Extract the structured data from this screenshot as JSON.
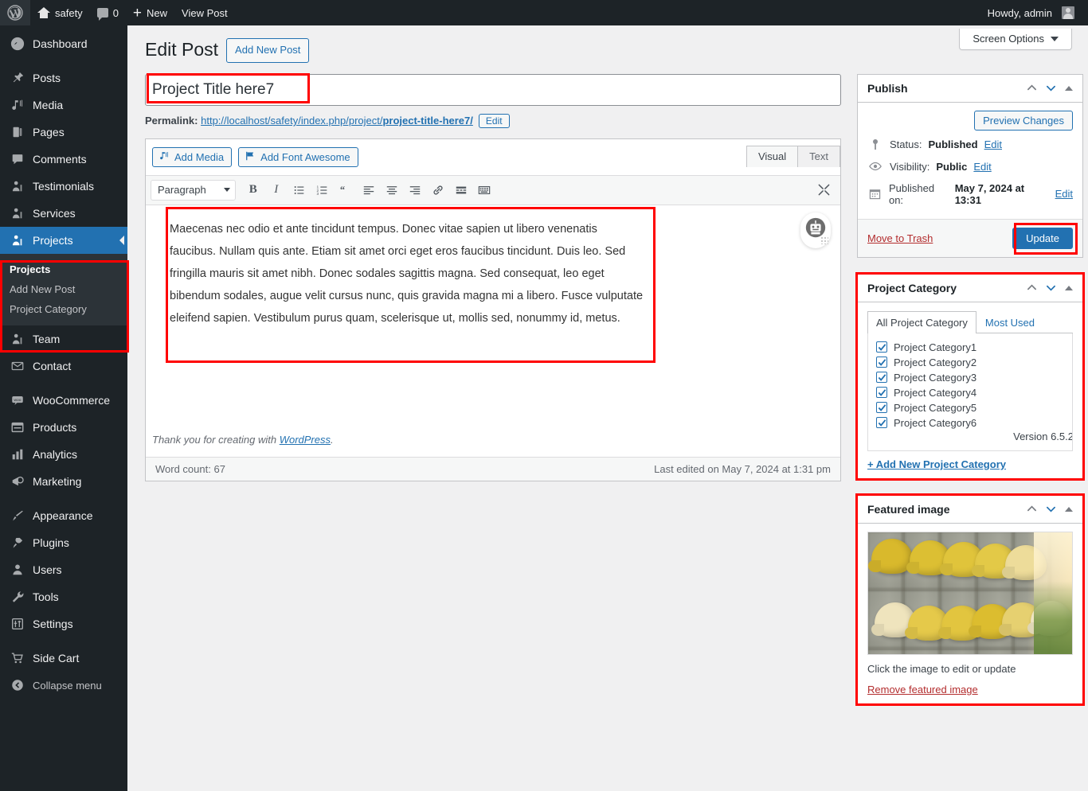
{
  "adminbar": {
    "logo_icon": "wordpress-logo-icon",
    "site_name": "safety",
    "comment_count": "0",
    "new_label": "New",
    "view_post_label": "View Post",
    "howdy": "Howdy, admin"
  },
  "sidebar": {
    "items": [
      {
        "label": "Dashboard",
        "icon": "dashboard-icon"
      },
      {
        "label": "Posts",
        "icon": "pin-icon"
      },
      {
        "label": "Media",
        "icon": "media-icon"
      },
      {
        "label": "Pages",
        "icon": "pages-icon"
      },
      {
        "label": "Comments",
        "icon": "comments-icon"
      },
      {
        "label": "Testimonials",
        "icon": "person-icon"
      },
      {
        "label": "Services",
        "icon": "person-icon"
      },
      {
        "label": "Projects",
        "icon": "person-icon",
        "current": true
      },
      {
        "label": "Team",
        "icon": "person-icon"
      },
      {
        "label": "Contact",
        "icon": "envelope-icon"
      },
      {
        "label": "WooCommerce",
        "icon": "woo-icon"
      },
      {
        "label": "Products",
        "icon": "products-icon"
      },
      {
        "label": "Analytics",
        "icon": "chart-bar-icon"
      },
      {
        "label": "Marketing",
        "icon": "megaphone-icon"
      },
      {
        "label": "Appearance",
        "icon": "paintbrush-icon"
      },
      {
        "label": "Plugins",
        "icon": "plug-icon"
      },
      {
        "label": "Users",
        "icon": "user-icon"
      },
      {
        "label": "Tools",
        "icon": "wrench-icon"
      },
      {
        "label": "Settings",
        "icon": "sliders-icon"
      },
      {
        "label": "Side Cart",
        "icon": "cart-icon"
      }
    ],
    "projects_submenu": [
      {
        "label": "Projects",
        "current": true
      },
      {
        "label": "Add New Post",
        "current": false
      },
      {
        "label": "Project Category",
        "current": false
      }
    ],
    "collapse_label": "Collapse menu"
  },
  "screen_options": {
    "label": "Screen Options"
  },
  "page": {
    "title": "Edit Post",
    "add_new_label": "Add New Post"
  },
  "post": {
    "title_value": "Project Title here7",
    "title_placeholder": "Add title",
    "permalink_label": "Permalink:",
    "permalink_base": "http://localhost/safety/index.php/project/",
    "permalink_slug": "project-title-here7/",
    "permalink_edit_label": "Edit"
  },
  "editor": {
    "add_media_label": "Add Media",
    "add_font_awesome_label": "Add Font Awesome",
    "tab_visual": "Visual",
    "tab_text": "Text",
    "format_select": "Paragraph",
    "toolbar_icons": [
      "bold-icon",
      "italic-icon",
      "bulleted-list-icon",
      "numbered-list-icon",
      "blockquote-icon",
      "align-left-icon",
      "align-center-icon",
      "align-right-icon",
      "link-icon",
      "read-more-icon",
      "toolbar-toggle-icon"
    ],
    "fullscreen_icon": "fullscreen-icon",
    "body_text": "Maecenas nec odio et ante tincidunt tempus. Donec vitae sapien ut libero venenatis faucibus. Nullam quis ante. Etiam sit amet orci eget eros faucibus tincidunt. Duis leo. Sed fringilla mauris sit amet nibh. Donec sodales sagittis magna. Sed consequat, leo eget bibendum sodales, augue velit cursus nunc, quis gravida magna mi a libero. Fusce vulputate eleifend sapien. Vestibulum purus quam, scelerisque ut, mollis sed, nonummy id, metus.",
    "assistant_icon": "robot-assistant-icon",
    "thanks_prefix": "Thank you for creating with ",
    "thanks_link": "WordPress",
    "thanks_suffix": ".",
    "word_count": "Word count: 67",
    "last_edited": "Last edited on May 7, 2024 at 1:31 pm"
  },
  "publish_box": {
    "title": "Publish",
    "preview_label": "Preview Changes",
    "status_label": "Status:",
    "status_value": "Published",
    "status_edit": "Edit",
    "visibility_label": "Visibility:",
    "visibility_value": "Public",
    "visibility_edit": "Edit",
    "published_label": "Published on:",
    "published_value": "May 7, 2024 at 13:31",
    "published_edit": "Edit",
    "trash_label": "Move to Trash",
    "update_label": "Update"
  },
  "category_box": {
    "title": "Project Category",
    "tab_all": "All Project Category",
    "tab_most_used": "Most Used",
    "items": [
      {
        "label": "Project Category1",
        "checked": true
      },
      {
        "label": "Project Category2",
        "checked": true
      },
      {
        "label": "Project Category3",
        "checked": true
      },
      {
        "label": "Project Category4",
        "checked": true
      },
      {
        "label": "Project Category5",
        "checked": true
      },
      {
        "label": "Project Category6",
        "checked": true
      }
    ],
    "version_text": "Version 6.5.2",
    "add_new_label": "+ Add New Project Category"
  },
  "featured_box": {
    "title": "Featured image",
    "image_alt": "Rows of yellow hard hats hanging on lockers",
    "caption": "Click the image to edit or update",
    "remove_label": "Remove featured image"
  },
  "colors": {
    "accent": "#2271b1",
    "admin_bg": "#1d2327",
    "highlight": "#ff0000",
    "danger": "#b32d2e"
  }
}
